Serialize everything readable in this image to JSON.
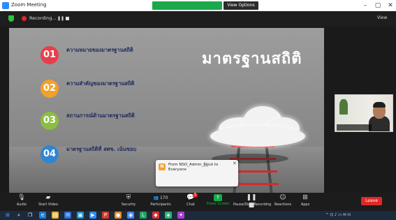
{
  "window": {
    "title": "Zoom Meeting",
    "minimize": "–",
    "restore": "▢",
    "close": "✕"
  },
  "share_banner": "",
  "view_options": "View Options",
  "top": {
    "recording_label": "Recording...",
    "pause": "❚❚",
    "view": "View"
  },
  "slide": {
    "title": "มาตรฐานสถิติ",
    "overlay_note": "",
    "items": [
      {
        "num": "01",
        "heading": "ความหมายของมาตรฐานสถิติ",
        "sub1": "",
        "sub2": "",
        "color": "#e83e4c"
      },
      {
        "num": "02",
        "heading": "ความสำคัญของมาตรฐานสถิติ",
        "sub1": "",
        "sub2": "",
        "color": "#f2a12b"
      },
      {
        "num": "03",
        "heading": "สถานการณ์ด้านมาตรฐานสถิติ",
        "sub1": "",
        "sub2": "",
        "color": "#8cbf3f"
      },
      {
        "num": "04",
        "heading": "มาตรฐานสถิติที่ สศช. เน้นชอบ",
        "sub1": "",
        "sub2": "",
        "color": "#2f86d3"
      }
    ]
  },
  "participant": {
    "name": ""
  },
  "chat": {
    "avatar": "N",
    "from": "From NSO_Admin_ผู้ดูแล to Everyone",
    "message": "",
    "close": "✕"
  },
  "toolbar": {
    "items": [
      {
        "label": "Audio",
        "icon": "microphone-icon"
      },
      {
        "label": "Start Video",
        "icon": "video-icon"
      },
      {
        "label": "Security",
        "icon": "shield-icon"
      },
      {
        "label": "Participants",
        "icon": "participants-icon",
        "count": "170"
      },
      {
        "label": "Chat",
        "icon": "chat-icon",
        "count": "1"
      },
      {
        "label": "Share Screen",
        "icon": "share-screen-icon"
      },
      {
        "label": "Pause/Stop Recording",
        "icon": "recording-icon"
      },
      {
        "label": "Reactions",
        "icon": "reactions-icon"
      },
      {
        "label": "Apps",
        "icon": "apps-icon"
      }
    ],
    "leave": "Leave",
    "colors": {
      "share": "#19a84a",
      "leave": "#e02828"
    }
  },
  "taskbar": {
    "weather": "",
    "clock_time": "",
    "clock_date": ""
  }
}
